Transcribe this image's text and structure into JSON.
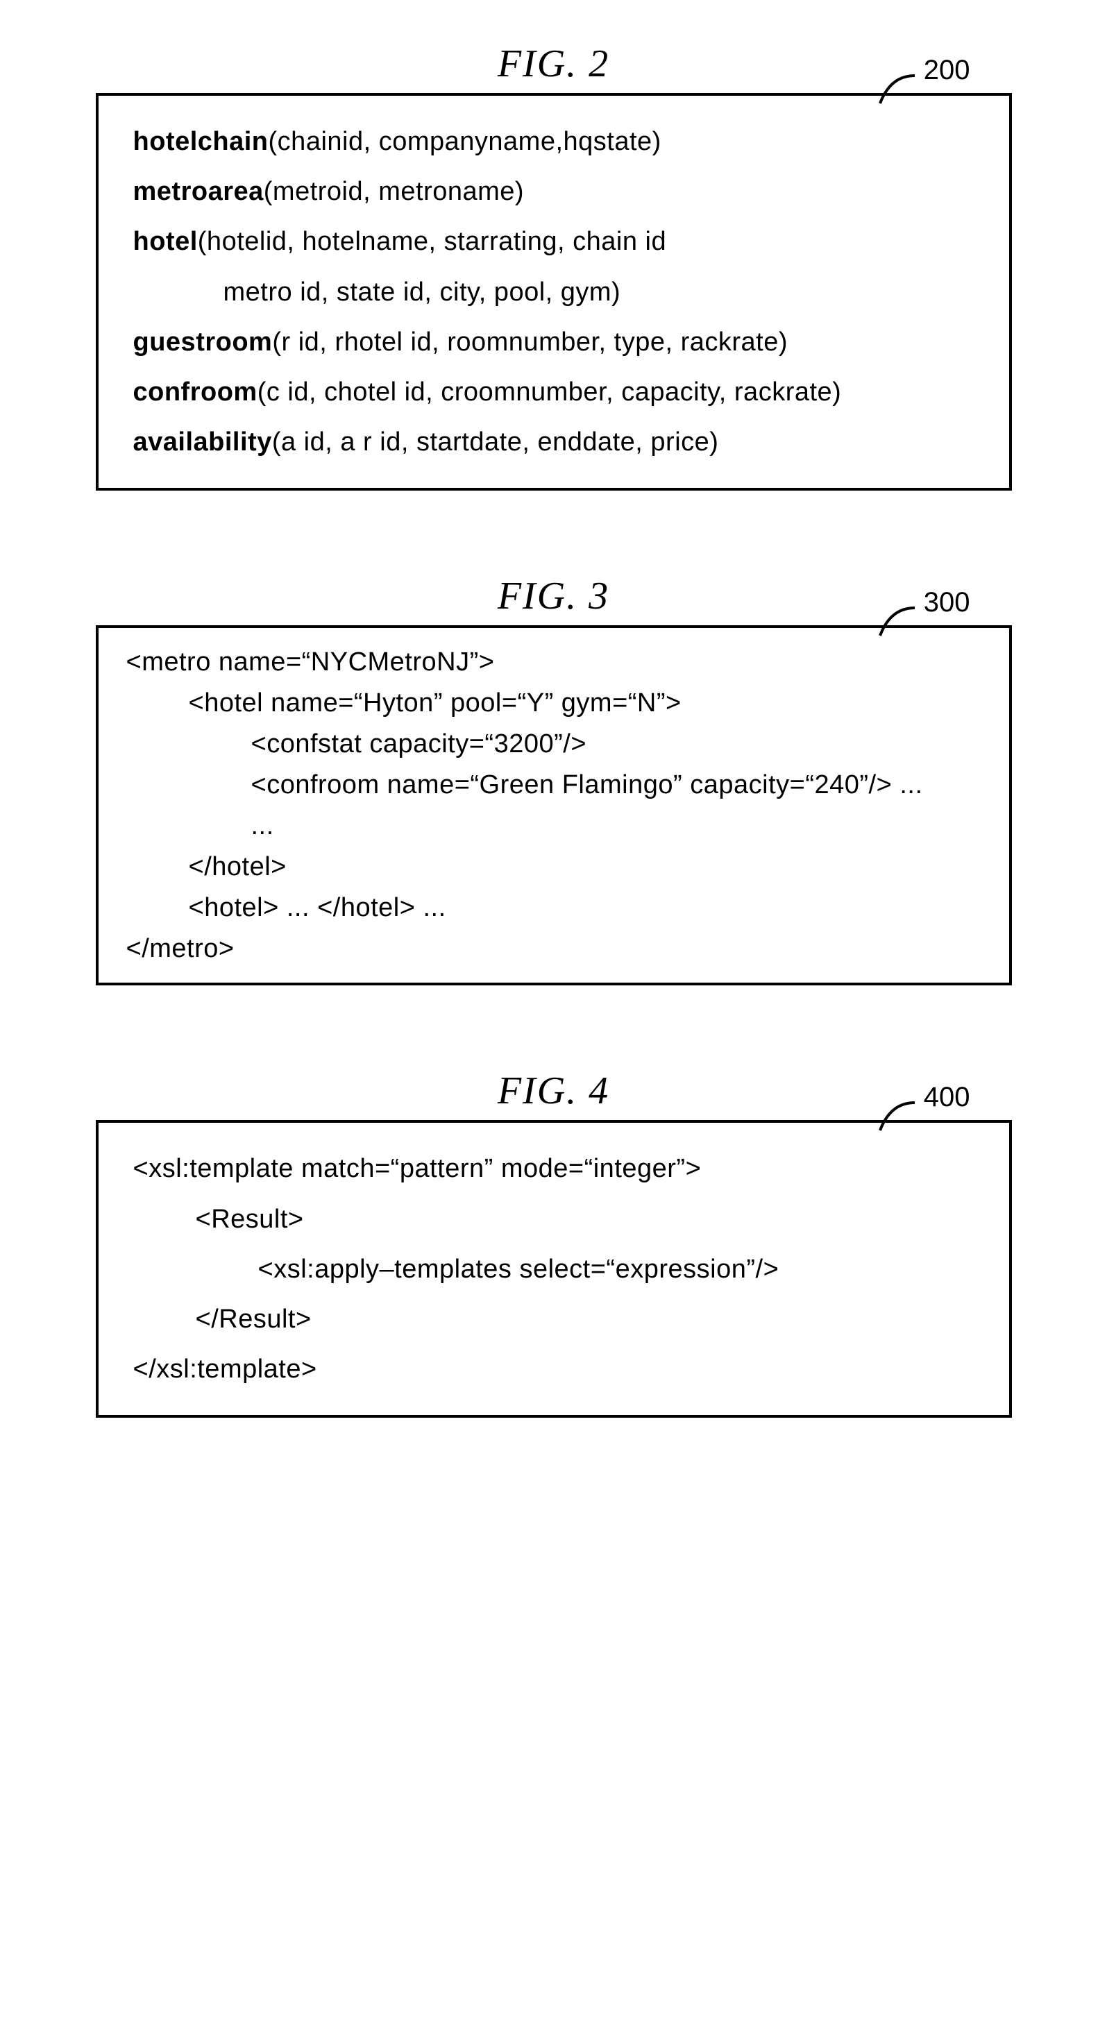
{
  "fig2": {
    "title": "FIG.  2",
    "ref": "200",
    "rows": [
      {
        "name": "hotelchain",
        "args": "(chainid, companyname,hqstate)"
      },
      {
        "name": "metroarea",
        "args": "(metroid, metroname)"
      },
      {
        "name": "hotel",
        "args": "(hotelid, hotelname, starrating, chain id"
      },
      {
        "cont": "metro id, state id, city, pool, gym)"
      },
      {
        "name": "guestroom",
        "args": "(r id, rhotel id, roomnumber, type, rackrate)"
      },
      {
        "name": "confroom",
        "args": "(c id, chotel id, croomnumber, capacity, rackrate)"
      },
      {
        "name": "availability",
        "args": "(a id, a r id, startdate, enddate, price)"
      }
    ]
  },
  "fig3": {
    "title": "FIG.  3",
    "ref": "300",
    "lines": [
      {
        "ind": 0,
        "t": "<metro name=“NYCMetroNJ”>"
      },
      {
        "ind": 1,
        "t": "<hotel name=“Hyton” pool=“Y” gym=“N”>"
      },
      {
        "ind": 2,
        "t": "<confstat capacity=“3200”/>"
      },
      {
        "ind": 2,
        "t": "<confroom name=“Green Flamingo” capacity=“240”/> ..."
      },
      {
        "ind": 2,
        "t": "..."
      },
      {
        "ind": 1,
        "t": "</hotel>"
      },
      {
        "ind": 1,
        "t": "<hotel> ... </hotel> ..."
      },
      {
        "ind": 0,
        "t": "</metro>"
      }
    ]
  },
  "fig4": {
    "title": "FIG.  4",
    "ref": "400",
    "lines": [
      {
        "ind": 0,
        "t": "<xsl:template match=“pattern” mode=“integer”>"
      },
      {
        "ind": 1,
        "t": "<Result>"
      },
      {
        "ind": 2,
        "t": "<xsl:apply–templates select=“expression”/>"
      },
      {
        "ind": 1,
        "t": "</Result>"
      },
      {
        "ind": 0,
        "t": "</xsl:template>"
      }
    ]
  }
}
